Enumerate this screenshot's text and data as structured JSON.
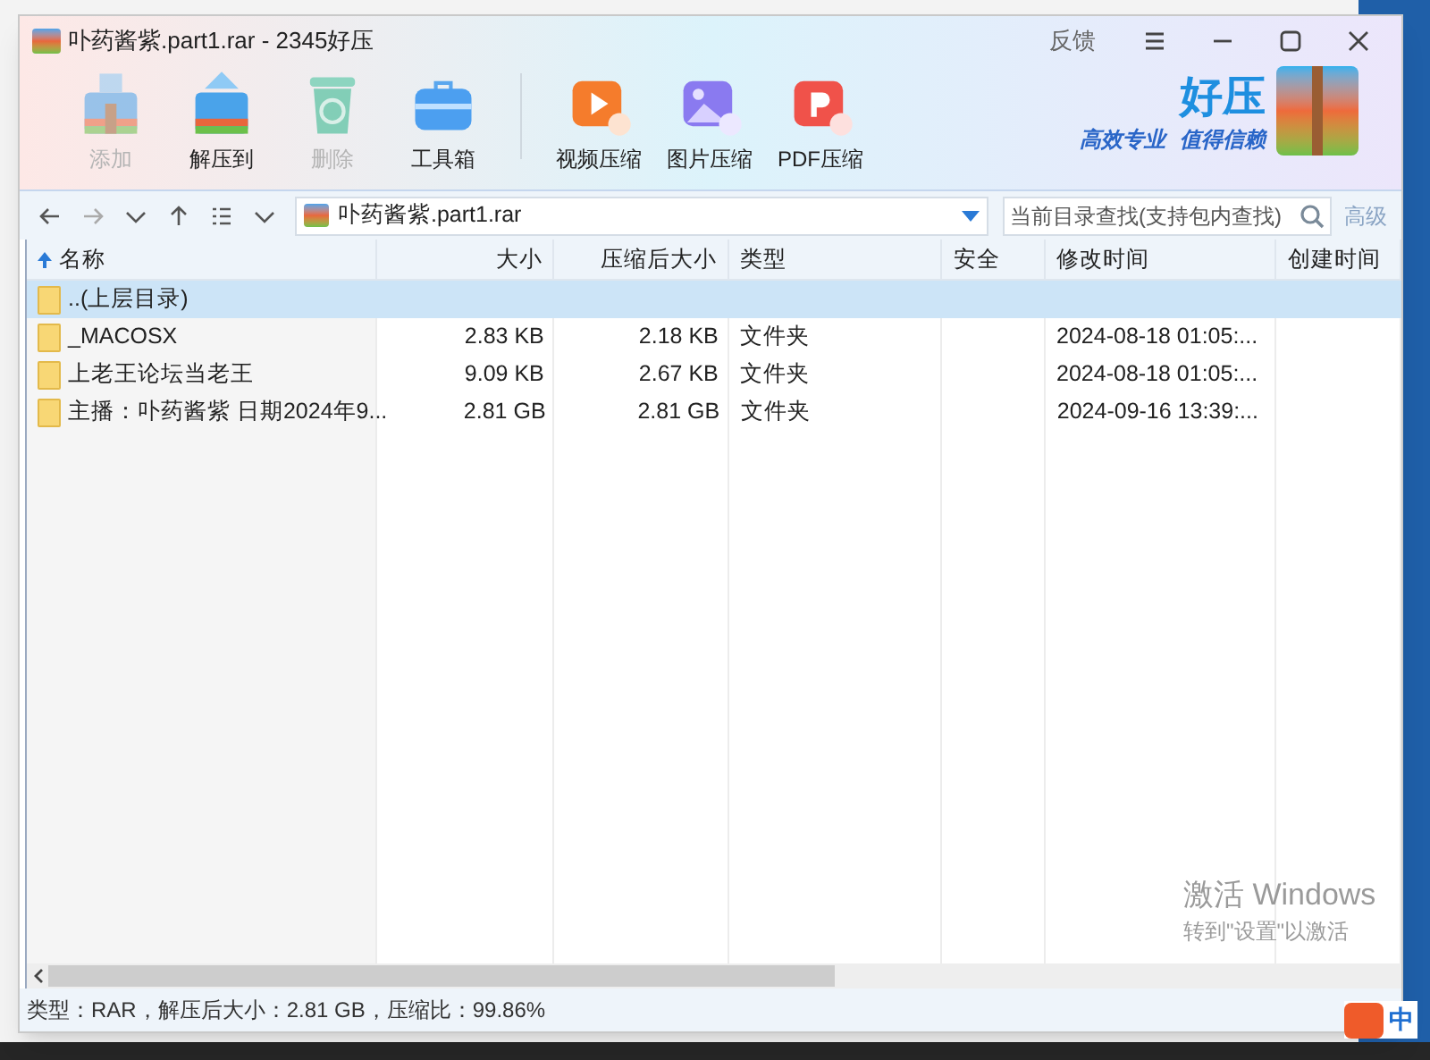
{
  "window": {
    "title": "卟药酱紫.part1.rar - 2345好压",
    "feedback": "反馈"
  },
  "toolbar": [
    {
      "label": "添加",
      "kind": "add",
      "disabled": true
    },
    {
      "label": "解压到",
      "kind": "extract",
      "disabled": false
    },
    {
      "label": "删除",
      "kind": "delete",
      "disabled": true
    },
    {
      "label": "工具箱",
      "kind": "toolbox",
      "disabled": false
    },
    {
      "label": "视频压缩",
      "kind": "video",
      "disabled": false
    },
    {
      "label": "图片压缩",
      "kind": "image",
      "disabled": false
    },
    {
      "label": "PDF压缩",
      "kind": "pdf",
      "disabled": false
    }
  ],
  "brand": {
    "name": "好压",
    "slogan_1": "高效专业",
    "slogan_2": "值得信赖"
  },
  "address": {
    "path": "卟药酱紫.part1.rar"
  },
  "search": {
    "placeholder": "当前目录查找(支持包内查找)",
    "advanced": "高级"
  },
  "table": {
    "columns": [
      {
        "label": "名称",
        "sorted": true
      },
      {
        "label": "大小",
        "sorted": false
      },
      {
        "label": "压缩后大小",
        "sorted": false
      },
      {
        "label": "类型",
        "sorted": false
      },
      {
        "label": "安全",
        "sorted": false
      },
      {
        "label": "修改时间",
        "sorted": false
      },
      {
        "label": "创建时间",
        "sorted": false
      }
    ],
    "rows": [
      {
        "name": "..(上层目录)",
        "selected": true
      },
      {
        "name": "_MACOSX",
        "size": "2.83 KB",
        "packed": "2.18 KB",
        "type": "文件夹",
        "modified": "2024-08-18 01:05:...",
        "selected": false
      },
      {
        "name": "上老王论坛当老王",
        "size": "9.09 KB",
        "packed": "2.67 KB",
        "type": "文件夹",
        "modified": "2024-08-18 01:05:...",
        "selected": false
      },
      {
        "name": "主播：卟药酱紫 日期2024年9...",
        "size": "2.81 GB",
        "packed": "2.81 GB",
        "type": "文件夹",
        "modified": "2024-09-16 13:39:...",
        "selected": false
      }
    ]
  },
  "status_bar": "类型：RAR，解压后大小：2.81 GB，压缩比：99.86%",
  "desktop": {
    "activation_title": "激活 Windows",
    "activation_hint": "转到\"设置\"以激活",
    "ime": "中"
  }
}
